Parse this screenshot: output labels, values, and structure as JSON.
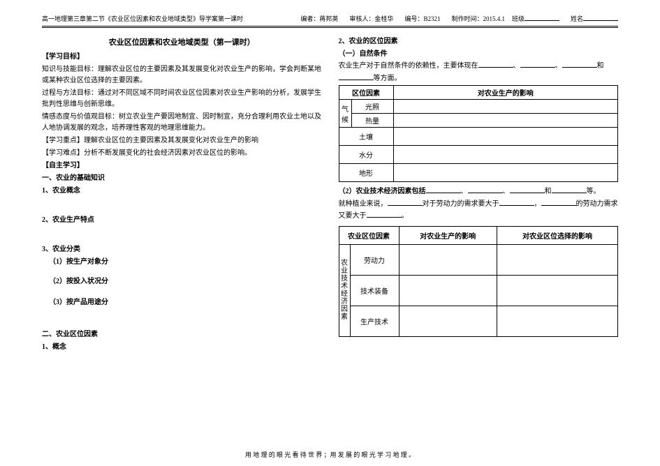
{
  "header": {
    "left": "高一地理第三章第二节《农业区位因素和农业地域类型》导学案第一课时",
    "author_label": "编者：",
    "author": "蒋邦英",
    "reviewer_label": "审核人：",
    "reviewer": "金桂华",
    "code_label": "编号：",
    "code": "B2321",
    "date_label": "制作时间：",
    "date": "2015.4.1",
    "class_label": "班级",
    "name_label": "姓名"
  },
  "col1": {
    "title": "农业区位因素和农业地域类型（第一课时）",
    "h_goal": "【学习目标】",
    "p_knowledge": "知识与技能目标：理解农业区位的主要因素及其发展变化对农业生产的影响，学会判断某地或某种农业区位选择的主要因素。",
    "p_process": "过程与方法目标：通过对不同区域不同时间农业区位因素对农业生产影响的分析，发展学生批判性思维与创新思维。",
    "p_emotion": "情感态度与价值观目标：树立农业生产要因地制宜、因时制宜，充分合理利用农业土地以及人地协调发展的观念，培养理性客观的地理思维能力。",
    "p_keypoint": "【学习重点】理解农业区位的主要因素及其发展变化对农业生产的影响",
    "p_difficult": "【学习难点】分析不断发展变化的社会经济因素对农业区位的影响。",
    "h_selfstudy": "【自主学习】",
    "h_basics": "一、农业的基础知识",
    "h_concept": "1、农业概念",
    "h_feature": "2、农业生产特点",
    "h_classify": "3、农业分类",
    "h_sub1": "（1）按生产对象分",
    "h_sub2": "（2）按投入状况分",
    "h_sub3": "（3）按产品用途分",
    "h_locfactor": "二、农业区位因素",
    "h_locconcept": "1、概念"
  },
  "col2": {
    "h_factor2": "2、农业的区位因素",
    "h_natural": "（一）自然条件",
    "p_natural_intro_a": "农业生产对于自然条件的依赖性，主要体现在",
    "p_natural_intro_b": "和",
    "p_natural_intro_c": "等方面。",
    "tbl1": {
      "th1": "区位因素",
      "th2": "对农业生产的影响",
      "climate": "气候",
      "light": "光照",
      "heat": "热量",
      "soil": "土壤",
      "water": "水分",
      "terrain": "地形"
    },
    "p_tech_a": "（2）农业技术经济因素包括",
    "p_tech_b": "和",
    "p_tech_c": "等。",
    "p_plant_a": "就种植业来说，",
    "p_plant_b": "对于劳动力的需求要大于",
    "p_plant_c": "的劳动力需求",
    "p_plant_d": "又要大于",
    "p_plant_e": "。",
    "tbl2": {
      "th1": "农业区位因素",
      "th2": "对农业生产的影响",
      "th3": "对农业区位选择的影响",
      "side": "农业技术经济因素",
      "r1": "劳动力",
      "r2": "技术装备",
      "r3": "生产技术"
    }
  },
  "footer": "用 地 理 的 眼 光 看 待 世 界 ；用 发 展 的 眼 光 学 习 地 理 。"
}
